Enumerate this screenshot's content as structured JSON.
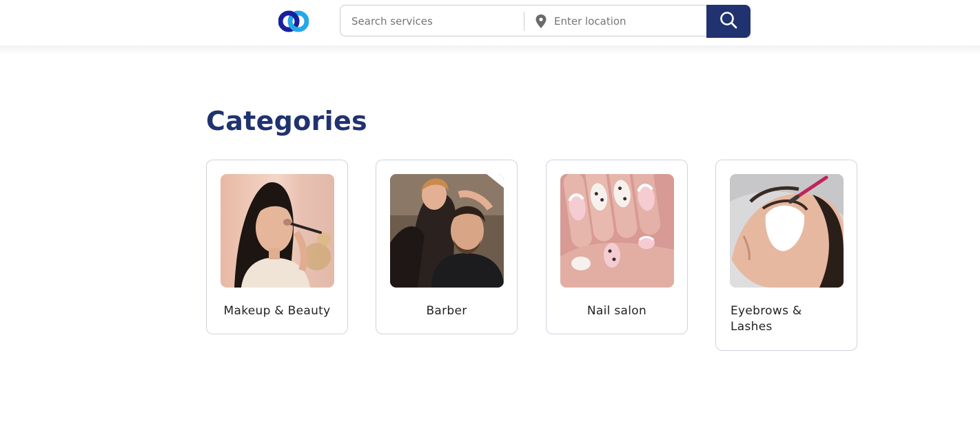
{
  "header": {
    "logo_icon": "interlocking-rings-logo",
    "search": {
      "placeholder": "Search services",
      "value": ""
    },
    "location": {
      "placeholder": "Enter location",
      "value": "",
      "icon": "map-pin-icon"
    },
    "search_button_icon": "search-icon",
    "accent_color": "#203270"
  },
  "main": {
    "title": "Categories",
    "categories": [
      {
        "label": "Makeup & Beauty",
        "image": "woman-applying-makeup-photo"
      },
      {
        "label": "Barber",
        "image": "barber-cutting-hair-photo"
      },
      {
        "label": "Nail salon",
        "image": "manicured-nails-photo"
      },
      {
        "label": "Eyebrows & Lashes",
        "image": "eyelash-extension-photo"
      }
    ]
  }
}
